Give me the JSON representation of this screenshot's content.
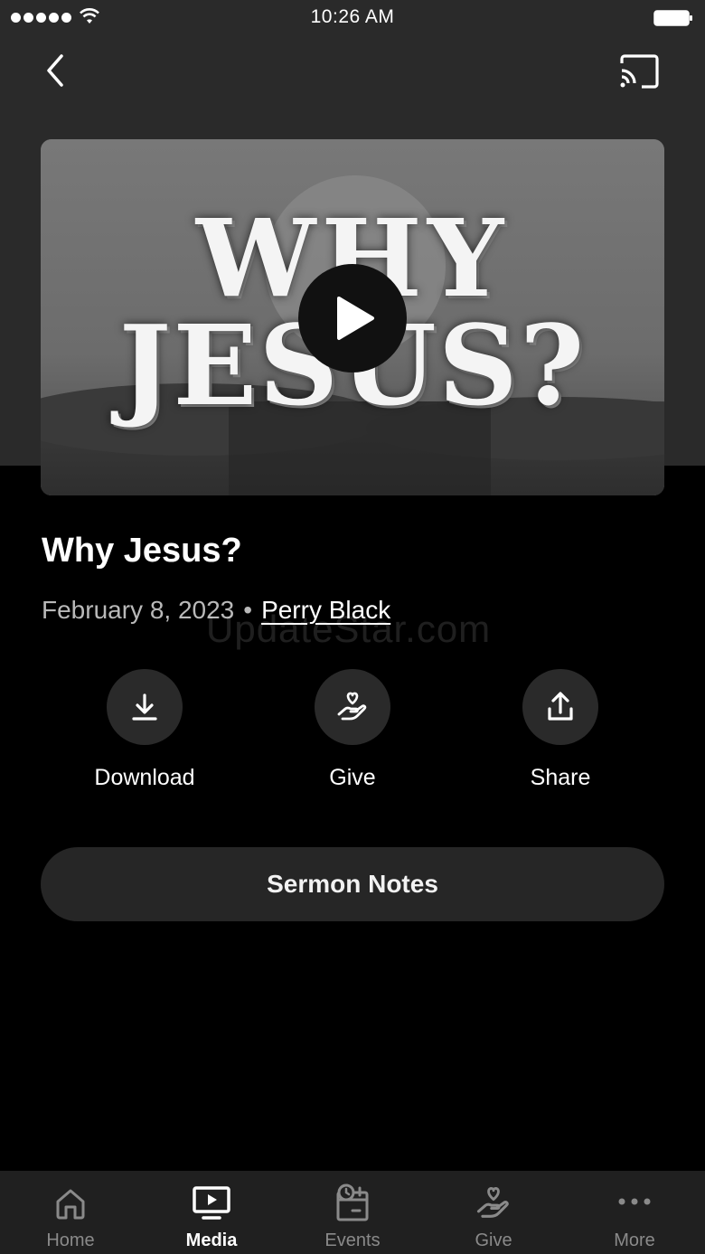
{
  "status_bar": {
    "time": "10:26 AM"
  },
  "hero": {
    "line1": "WHY",
    "line2": "JESUS?"
  },
  "sermon": {
    "title": "Why Jesus?",
    "date": "February 8, 2023",
    "separator": "•",
    "speaker": "Perry Black"
  },
  "watermark": "UpdateStar.com",
  "actions": [
    {
      "label": "Download",
      "icon": "download-icon"
    },
    {
      "label": "Give",
      "icon": "give-hand-heart-icon"
    },
    {
      "label": "Share",
      "icon": "share-icon"
    }
  ],
  "notes_button": "Sermon Notes",
  "tabs": [
    {
      "label": "Home",
      "icon": "home-icon",
      "active": false
    },
    {
      "label": "Media",
      "icon": "media-play-icon",
      "active": true
    },
    {
      "label": "Events",
      "icon": "events-calendar-icon",
      "active": false
    },
    {
      "label": "Give",
      "icon": "give-hand-heart-icon",
      "active": false
    },
    {
      "label": "More",
      "icon": "more-dots-icon",
      "active": false
    }
  ],
  "colors": {
    "background": "#000000",
    "header": "#2a2a2a",
    "surface": "#262626",
    "tab_bar": "#202020",
    "muted_text": "#b9b9b9",
    "inactive_tab": "#8a8a8a"
  }
}
